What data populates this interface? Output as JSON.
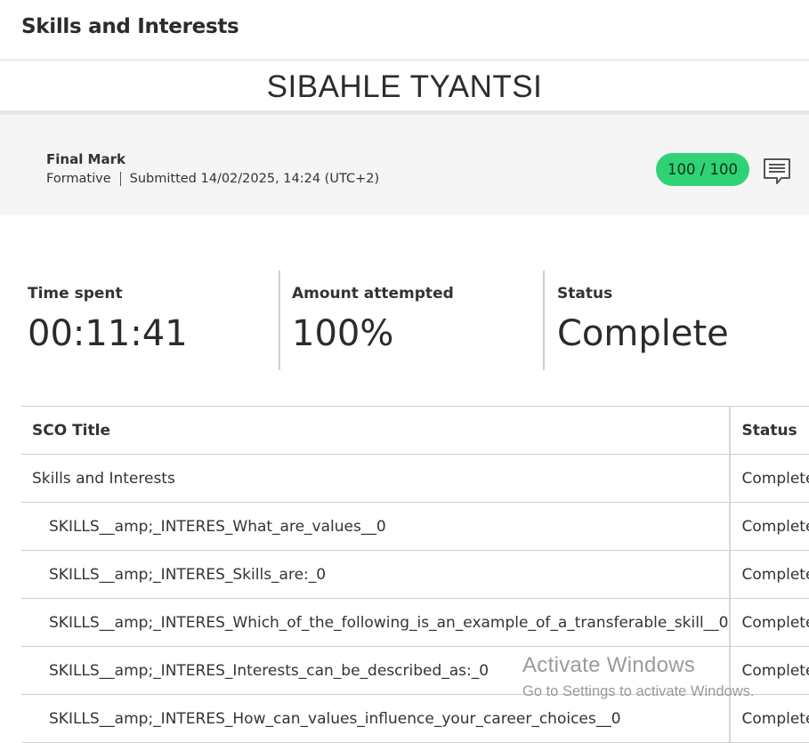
{
  "header": {
    "title": "Skills and Interests"
  },
  "student": {
    "name": "SIBAHLE TYANTSI"
  },
  "grade": {
    "label": "Final Mark",
    "type": "Formative",
    "submitted": "Submitted 14/02/2025, 14:24 (UTC+2)",
    "score": "100 / 100",
    "score_color": "#2fd375",
    "comment_icon": "comment-icon"
  },
  "stats": [
    {
      "label": "Time spent",
      "value": "00:11:41"
    },
    {
      "label": "Amount attempted",
      "value": "100%"
    },
    {
      "label": "Status",
      "value": "Complete"
    }
  ],
  "table": {
    "headers": [
      "SCO Title",
      "Status"
    ],
    "rows": [
      {
        "title": "Skills and Interests",
        "status": "Complete"
      },
      {
        "title": "SKILLS__amp;_INTERES_What_are_values__0",
        "status": "Complete"
      },
      {
        "title": "SKILLS__amp;_INTERES_Skills_are:_0",
        "status": "Complete"
      },
      {
        "title": "SKILLS__amp;_INTERES_Which_of_the_following_is_an_example_of_a_transferable_skill__0",
        "status": "Complete"
      },
      {
        "title": "SKILLS__amp;_INTERES_Interests_can_be_described_as:_0",
        "status": "Complete"
      },
      {
        "title": "SKILLS__amp;_INTERES_How_can_values_influence_your_career_choices__0",
        "status": "Complete"
      }
    ]
  },
  "watermark": {
    "line1": "Activate Windows",
    "line2": "Go to Settings to activate Windows."
  }
}
